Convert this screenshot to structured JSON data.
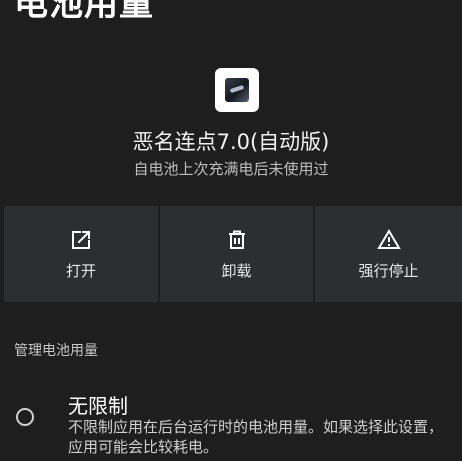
{
  "header": {
    "title": "电池用量"
  },
  "app": {
    "icon": "app-icon",
    "name": "恶名连点7.0(自动版)",
    "subtitle": "自电池上次充满电后未使用过"
  },
  "actions": [
    {
      "label": "打开",
      "icon": "open-in-new-icon"
    },
    {
      "label": "卸载",
      "icon": "trash-icon"
    },
    {
      "label": "强行停止",
      "icon": "warning-icon"
    }
  ],
  "battery": {
    "section_title": "管理电池用量",
    "options": [
      {
        "title": "无限制",
        "description": "不限制应用在后台运行时的电池用量。如果选择此设置，应用可能会比较耗电。",
        "selected": false
      }
    ]
  },
  "colors": {
    "background": "#1e1e1e",
    "card": "#2d2e30",
    "text_primary": "#ffffff",
    "text_secondary": "#bdbdbd"
  }
}
